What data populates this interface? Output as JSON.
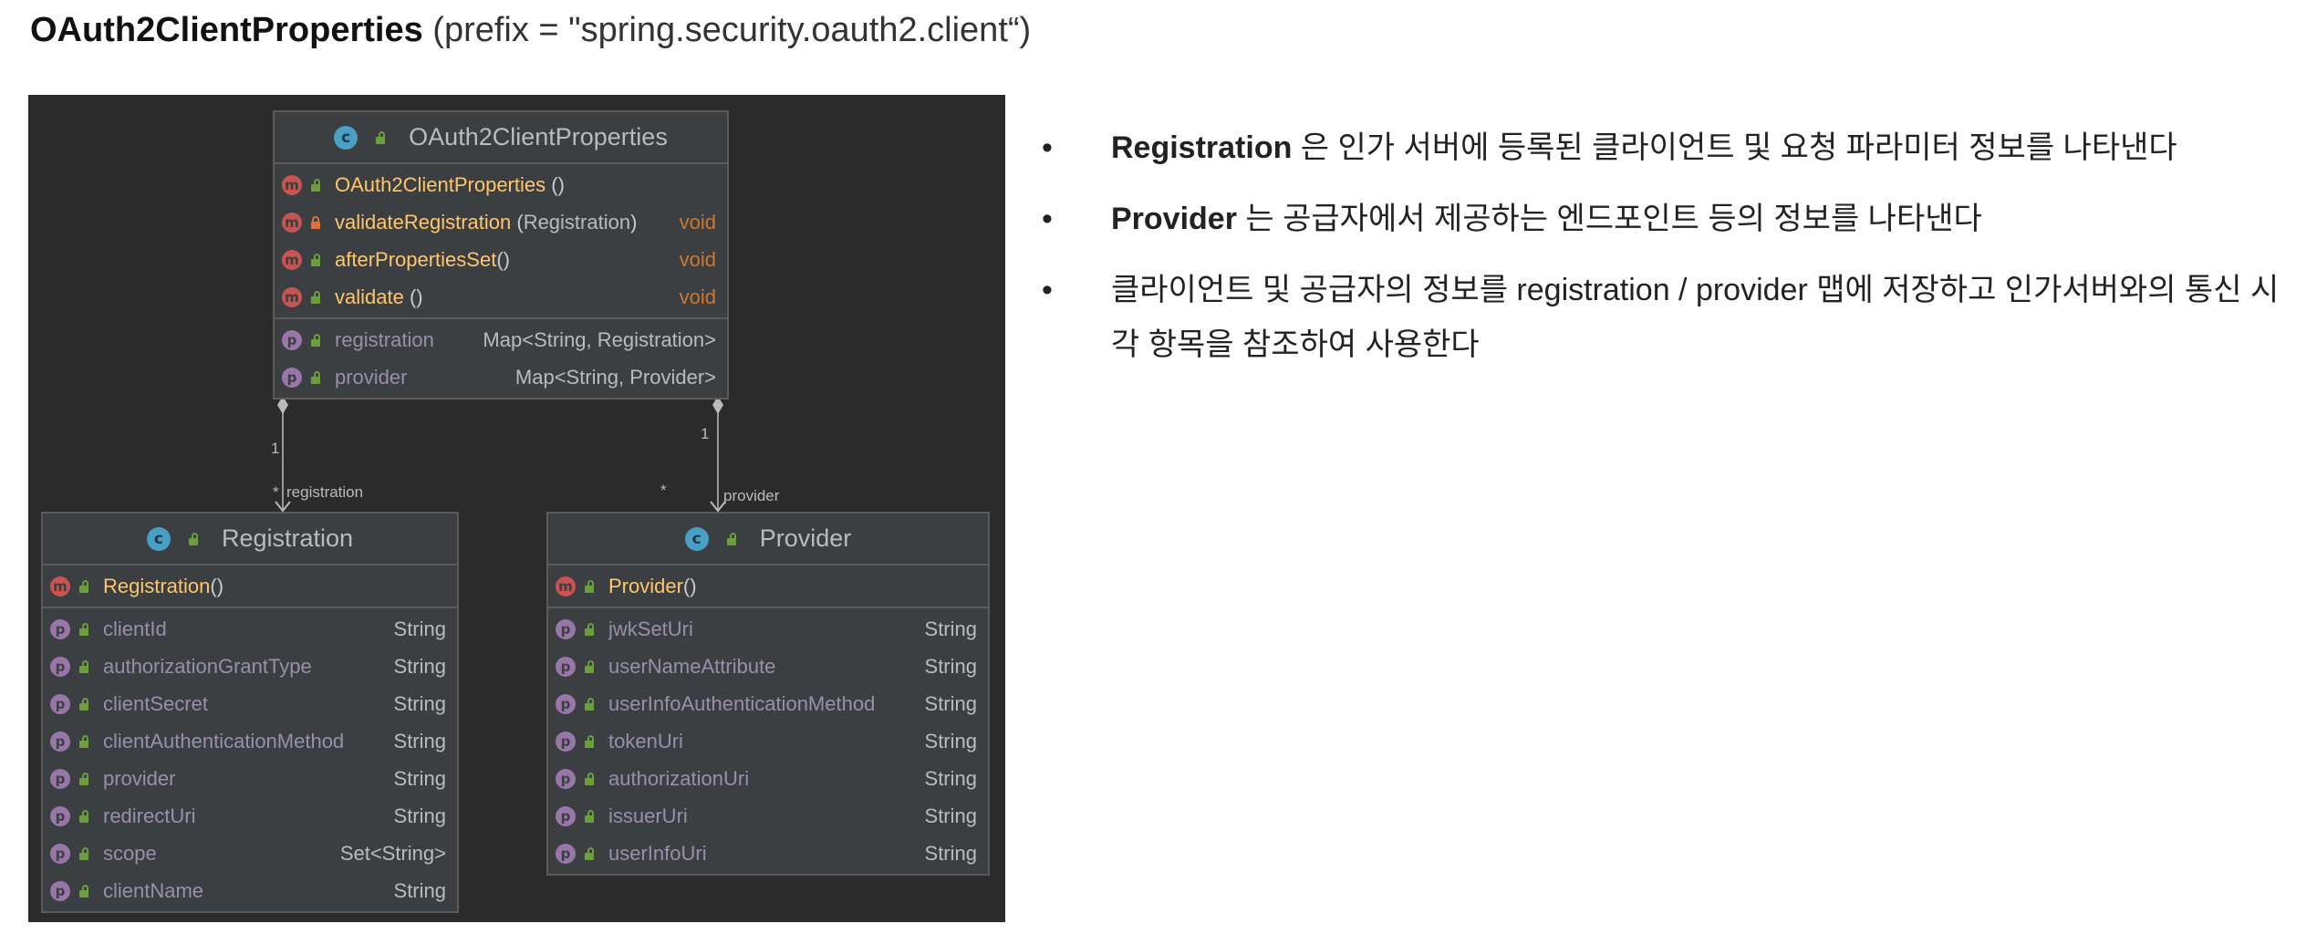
{
  "title": {
    "class_name": "OAuth2ClientProperties",
    "prefix": "(prefix = \"spring.security.oauth2.client“)"
  },
  "diagram": {
    "main": {
      "icon": "class-icon",
      "name": "OAuth2ClientProperties",
      "methods": [
        {
          "name": "OAuth2ClientProperties",
          "args": "",
          "type": "",
          "access": "public"
        },
        {
          "name": "validateRegistration",
          "args": "Registration",
          "type": "void",
          "access": "private"
        },
        {
          "name": "afterPropertiesSet",
          "args": "",
          "type": "void",
          "access": "public"
        },
        {
          "name": "validate",
          "args": "",
          "type": "void",
          "access": "public"
        }
      ],
      "properties": [
        {
          "name": "registration",
          "type": "Map<String, Registration>"
        },
        {
          "name": "provider",
          "type": "Map<String, Provider>"
        }
      ]
    },
    "registration": {
      "icon": "class-icon",
      "name": "Registration",
      "constructor": "Registration",
      "properties": [
        {
          "name": "clientId",
          "type": "String"
        },
        {
          "name": "authorizationGrantType",
          "type": "String"
        },
        {
          "name": "clientSecret",
          "type": "String"
        },
        {
          "name": "clientAuthenticationMethod",
          "type": "String"
        },
        {
          "name": "provider",
          "type": "String"
        },
        {
          "name": "redirectUri",
          "type": "String"
        },
        {
          "name": "scope",
          "type": "Set<String>"
        },
        {
          "name": "clientName",
          "type": "String"
        }
      ]
    },
    "provider": {
      "icon": "class-icon",
      "name": "Provider",
      "constructor": "Provider",
      "properties": [
        {
          "name": "jwkSetUri",
          "type": "String"
        },
        {
          "name": "userNameAttribute",
          "type": "String"
        },
        {
          "name": "userInfoAuthenticationMethod",
          "type": "String"
        },
        {
          "name": "tokenUri",
          "type": "String"
        },
        {
          "name": "authorizationUri",
          "type": "String"
        },
        {
          "name": "issuerUri",
          "type": "String"
        },
        {
          "name": "userInfoUri",
          "type": "String"
        }
      ]
    },
    "connectors": {
      "left": {
        "from_mult": "1",
        "to_mult": "*",
        "role": "registration"
      },
      "right": {
        "from_mult": "1",
        "to_mult": "*",
        "role": "provider"
      }
    }
  },
  "bullets": [
    {
      "bold": "Registration",
      "text": " 은 인가 서버에 등록된 클라이언트 및 요청 파라미터 정보를 나타낸다"
    },
    {
      "bold": "Provider",
      "text": " 는 공급자에서 제공하는 엔드포인트 등의 정보를 나타낸다"
    },
    {
      "bold": "",
      "text": "클라이언트 및 공급자의 정보를 registration / provider 맵에 저장하고 인가서버와의 통신 시 각 항목을 참조하여 사용한다"
    }
  ],
  "colors": {
    "diagram_bg": "#2b2b2b",
    "box_bg": "#3c3f41",
    "method_name": "#ffc66d",
    "property_name": "#9a8faa",
    "void_type": "#cc7832"
  }
}
